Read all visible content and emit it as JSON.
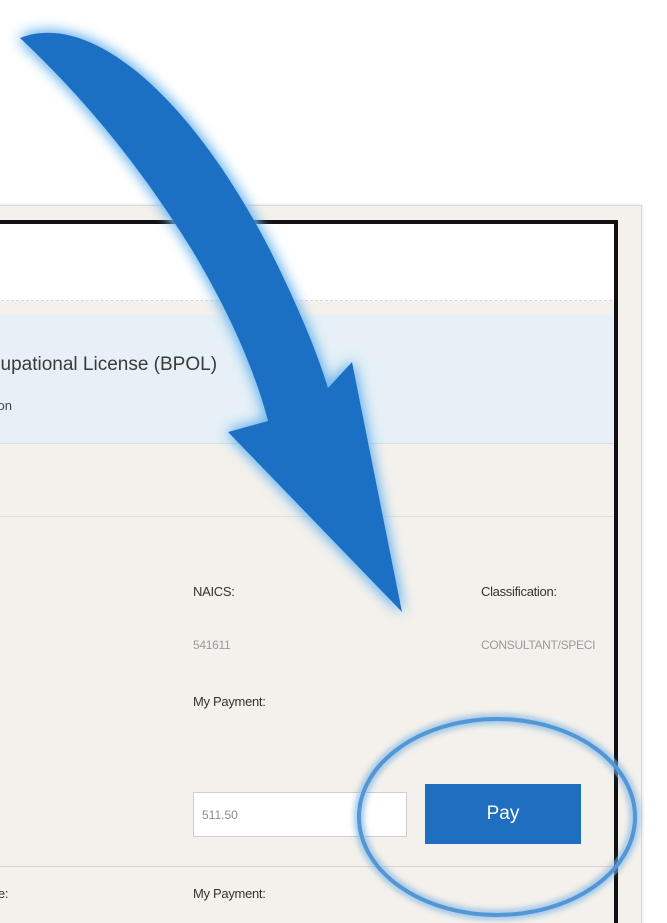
{
  "license": {
    "title": "cupational License (BPOL)",
    "subtitle": "tion"
  },
  "fields": {
    "naics_label": "NAICS:",
    "naics_value": "541611",
    "classification_label": "Classification:",
    "classification_value": "CONSULTANT/SPECI",
    "my_payment_label": "My Payment:",
    "my_payment_value": "511.50",
    "due_label_partial": "ue:",
    "my_payment_label_2": "My Payment:"
  },
  "actions": {
    "pay_label": "Pay"
  },
  "annotation": {
    "arrow_color": "#1a6fc4",
    "circle_color": "#1a6fc4"
  }
}
